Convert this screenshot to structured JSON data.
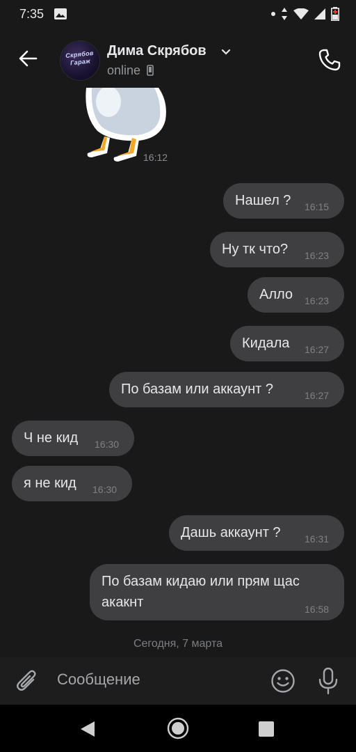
{
  "status_bar": {
    "time": "7:35"
  },
  "header": {
    "contact_name": "Дима Скрябов",
    "status": "online",
    "avatar_text": "Скрябов Гараж"
  },
  "sticker": {
    "time": "16:12"
  },
  "messages": [
    {
      "dir": "out",
      "text": "Нашел ?",
      "time": "16:15"
    },
    {
      "dir": "out",
      "text": "Ну тк что?",
      "time": "16:23"
    },
    {
      "dir": "out",
      "text": "Алло",
      "time": "16:23"
    },
    {
      "dir": "out",
      "text": "Кидала",
      "time": "16:27"
    },
    {
      "dir": "out",
      "text": "По базам или аккаунт ?",
      "time": "16:27"
    },
    {
      "dir": "in",
      "text": "Ч не кид",
      "time": "16:30"
    },
    {
      "dir": "in",
      "text": "я не кид",
      "time": "16:30"
    },
    {
      "dir": "out",
      "text": "Дашь аккаунт ?",
      "time": "16:31"
    },
    {
      "dir": "out",
      "text_line1": "По базам кидаю или прям щас",
      "text_line2": "акакнт",
      "time": "16:58"
    }
  ],
  "date_separator": "Сегодня, 7 марта",
  "composer": {
    "placeholder": "Сообщение"
  },
  "colors": {
    "background": "#19191a",
    "bubble": "#3f3f41",
    "accent": "#ffffff"
  }
}
